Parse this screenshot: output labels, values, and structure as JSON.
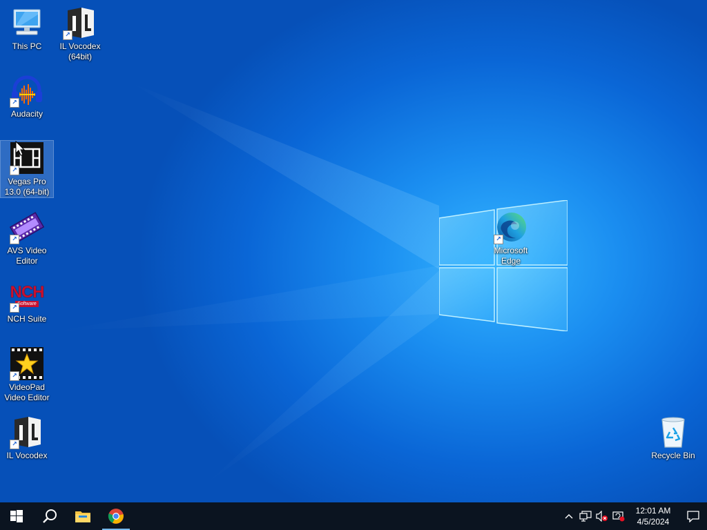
{
  "desktop": {
    "icons": [
      {
        "label": "This PC",
        "icon": "this-pc-icon"
      },
      {
        "label": "IL Vocodex\n(64bit)",
        "icon": "il-vocodex-icon"
      },
      {
        "label": "Audacity",
        "icon": "audacity-icon"
      },
      {
        "label": "Vegas Pro\n13.0 (64-bit)",
        "icon": "vegas-pro-icon"
      },
      {
        "label": "AVS Video\nEditor",
        "icon": "avs-video-editor-icon"
      },
      {
        "label": "NCH Suite",
        "icon": "nch-suite-icon"
      },
      {
        "label": "VideoPad\nVideo Editor",
        "icon": "videopad-icon"
      },
      {
        "label": "IL Vocodex",
        "icon": "il-vocodex-icon"
      },
      {
        "label": "Microsoft\nEdge",
        "icon": "edge-icon"
      },
      {
        "label": "Recycle Bin",
        "icon": "recycle-bin-icon"
      }
    ],
    "nch_logo_text": "NCH",
    "nch_logo_sub": "Software",
    "il_logo_text": "IL"
  },
  "taskbar": {
    "start": "start-button",
    "search": "search-icon",
    "pinned": [
      "file-explorer-icon",
      "chrome-icon"
    ],
    "tray": {
      "chevron": "^",
      "icons": [
        "network-icon",
        "volume-muted-icon",
        "action-center-alert-icon"
      ]
    },
    "clock": {
      "time": "12:01 AM",
      "date": "4/5/2024"
    }
  },
  "colors": {
    "accent": "#0078d7",
    "taskbar": "#0b1420",
    "wallpaper": "#0a66d6"
  }
}
